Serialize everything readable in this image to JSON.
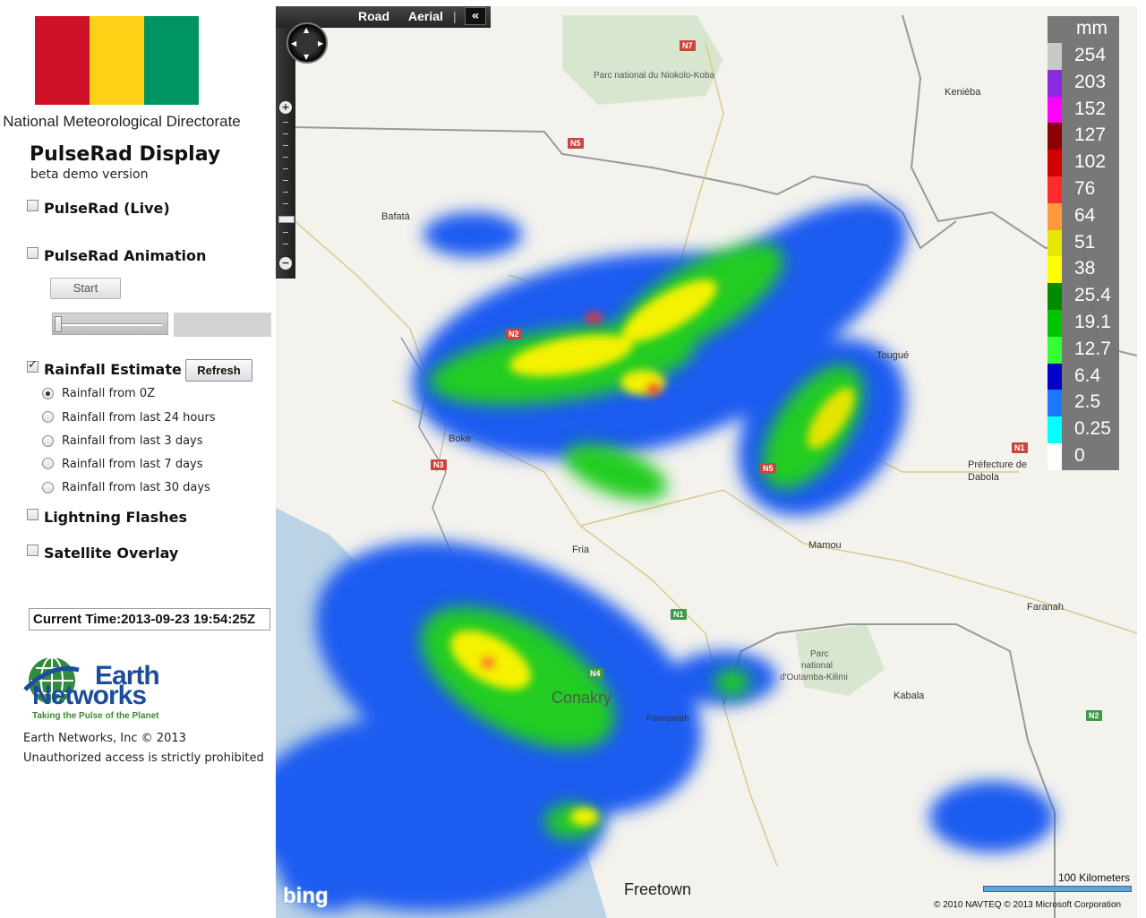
{
  "sidebar": {
    "flag_colors": [
      "#ce1126",
      "#fcd116",
      "#009460"
    ],
    "org_name": "National Meteorological Directorate",
    "title": "PulseRad Display",
    "subtitle": "beta demo version",
    "live_label": "PulseRad (Live)",
    "animation_label": "PulseRad Animation",
    "start_label": "Start",
    "rainfall_label": "Rainfall Estimate",
    "refresh_label": "Refresh",
    "rain_options": [
      "Rainfall from 0Z",
      "Rainfall from last 24 hours",
      "Rainfall from last 3 days",
      "Rainfall from last 7 days",
      "Rainfall from last 30 days"
    ],
    "lightning_label": "Lightning Flashes",
    "satellite_label": "Satellite Overlay",
    "current_time": "Current Time:2013-09-23 19:54:25Z",
    "logo_line1": "Earth",
    "logo_line2": "Networks",
    "logo_tagline": "Taking the Pulse of the Planet",
    "copyright": "Earth Networks, Inc © 2013",
    "warning": "Unauthorized access is strictly prohibited"
  },
  "map": {
    "road_label": "Road",
    "aerial_label": "Aerial",
    "collapse_label": "«",
    "places": {
      "niokolo": "Parc national du Niokolo-Koba",
      "kenieba": "Keniéba",
      "bafata": "Bafatá",
      "tougue": "Tougué",
      "boke": "Boke",
      "prefecture": "Préfecture de",
      "dabola": "Dabola",
      "fria": "Fria",
      "mamou": "Mamou",
      "faranah": "Faranah",
      "park1": "Parc",
      "park2": "national",
      "park3": "d'Outamba-Kilimi",
      "kabala": "Kabala",
      "conakry": "Conakry",
      "forecariah": "Forecariah",
      "freetown": "Freetown"
    },
    "shields": {
      "n7": "N7",
      "n5a": "N5",
      "n3": "N3",
      "n2a": "N2",
      "n1a": "N1",
      "n5b": "N5",
      "n1b": "N1",
      "n4": "N4",
      "n2b": "N2"
    },
    "bing": "bing",
    "scale_label": "100 Kilometers",
    "credit": "© 2010 NAVTEQ   © 2013 Microsoft Corporation"
  },
  "legend": {
    "unit": "mm",
    "items": [
      {
        "label": "254",
        "color": "#c8c8c8"
      },
      {
        "label": "203",
        "color": "#8a2be2"
      },
      {
        "label": "152",
        "color": "#ff00ff"
      },
      {
        "label": "127",
        "color": "#8b0000"
      },
      {
        "label": "102",
        "color": "#d00000"
      },
      {
        "label": "76",
        "color": "#ff2a2a"
      },
      {
        "label": "64",
        "color": "#ff9a3a"
      },
      {
        "label": "51",
        "color": "#e6e600"
      },
      {
        "label": "38",
        "color": "#ffff00"
      },
      {
        "label": "25.4",
        "color": "#008a00"
      },
      {
        "label": "19.1",
        "color": "#00c400"
      },
      {
        "label": "12.7",
        "color": "#33ff33"
      },
      {
        "label": "6.4",
        "color": "#0000cc"
      },
      {
        "label": "2.5",
        "color": "#1e78ff"
      },
      {
        "label": "0.25",
        "color": "#00ffff"
      },
      {
        "label": "0",
        "color": "#ffffff"
      }
    ]
  }
}
